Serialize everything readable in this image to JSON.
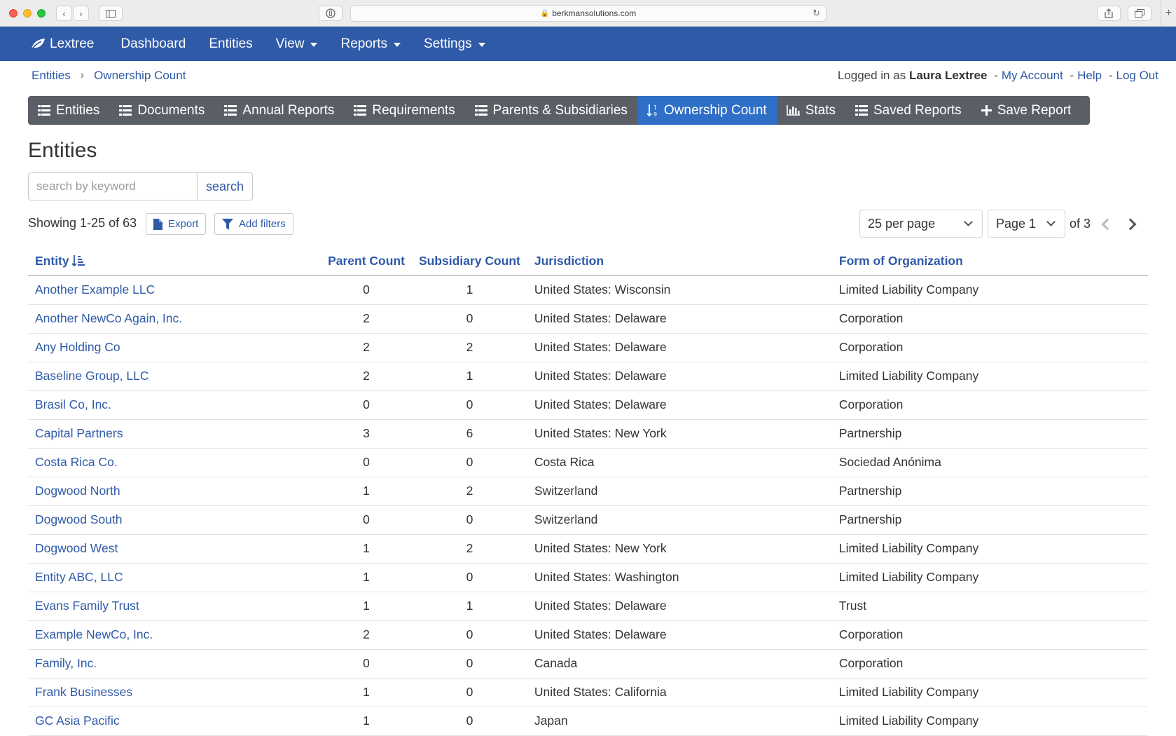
{
  "browser": {
    "url": "berkmansolutions.com"
  },
  "appnav": {
    "brand": "Lextree",
    "items": [
      {
        "label": "Dashboard",
        "dropdown": false
      },
      {
        "label": "Entities",
        "dropdown": false
      },
      {
        "label": "View",
        "dropdown": true
      },
      {
        "label": "Reports",
        "dropdown": true
      },
      {
        "label": "Settings",
        "dropdown": true
      }
    ]
  },
  "breadcrumb": {
    "items": [
      "Entities",
      "Ownership Count"
    ]
  },
  "user": {
    "prefix": "Logged in as",
    "name": "Laura Lextree",
    "my_account": "My Account",
    "help": "Help",
    "logout": "Log Out",
    "dash": "-"
  },
  "tabs": [
    {
      "label": "Entities",
      "icon": "list-icon",
      "active": false
    },
    {
      "label": "Documents",
      "icon": "list-icon",
      "active": false
    },
    {
      "label": "Annual Reports",
      "icon": "list-icon",
      "active": false
    },
    {
      "label": "Requirements",
      "icon": "list-icon",
      "active": false
    },
    {
      "label": "Parents & Subsidiaries",
      "icon": "list-icon",
      "active": false
    },
    {
      "label": "Ownership Count",
      "icon": "sort-numeric-icon",
      "active": true
    },
    {
      "label": "Stats",
      "icon": "bar-chart-icon",
      "active": false
    },
    {
      "label": "Saved Reports",
      "icon": "list-icon",
      "active": false
    },
    {
      "label": "Save Report",
      "icon": "plus-icon",
      "active": false
    }
  ],
  "page": {
    "title": "Entities"
  },
  "search": {
    "placeholder": "search by keyword",
    "value": "",
    "button": "search"
  },
  "toolbar": {
    "showing": "Showing 1-25 of 63",
    "export": "Export",
    "add_filters": "Add filters",
    "per_page": "25 per page",
    "page": "Page 1",
    "of_pages": "of 3"
  },
  "table": {
    "columns": [
      "Entity",
      "Parent Count",
      "Subsidiary Count",
      "Jurisdiction",
      "Form of Organization"
    ],
    "rows": [
      [
        "Another Example LLC",
        "0",
        "1",
        "United States: Wisconsin",
        "Limited Liability Company"
      ],
      [
        "Another NewCo Again, Inc.",
        "2",
        "0",
        "United States: Delaware",
        "Corporation"
      ],
      [
        "Any Holding Co",
        "2",
        "2",
        "United States: Delaware",
        "Corporation"
      ],
      [
        "Baseline Group, LLC",
        "2",
        "1",
        "United States: Delaware",
        "Limited Liability Company"
      ],
      [
        "Brasil Co, Inc.",
        "0",
        "0",
        "United States: Delaware",
        "Corporation"
      ],
      [
        "Capital Partners",
        "3",
        "6",
        "United States: New York",
        "Partnership"
      ],
      [
        "Costa Rica Co.",
        "0",
        "0",
        "Costa Rica",
        "Sociedad Anónima"
      ],
      [
        "Dogwood North",
        "1",
        "2",
        "Switzerland",
        "Partnership"
      ],
      [
        "Dogwood South",
        "0",
        "0",
        "Switzerland",
        "Partnership"
      ],
      [
        "Dogwood West",
        "1",
        "2",
        "United States: New York",
        "Limited Liability Company"
      ],
      [
        "Entity ABC, LLC",
        "1",
        "0",
        "United States: Washington",
        "Limited Liability Company"
      ],
      [
        "Evans Family Trust",
        "1",
        "1",
        "United States: Delaware",
        "Trust"
      ],
      [
        "Example NewCo, Inc.",
        "2",
        "0",
        "United States: Delaware",
        "Corporation"
      ],
      [
        "Family, Inc.",
        "0",
        "0",
        "Canada",
        "Corporation"
      ],
      [
        "Frank Businesses",
        "1",
        "0",
        "United States: California",
        "Limited Liability Company"
      ],
      [
        "GC Asia Pacific",
        "1",
        "0",
        "Japan",
        "Limited Liability Company"
      ]
    ]
  },
  "colors": {
    "nav": "#2f5aa8",
    "tabbar": "#5a5f67",
    "tab_active": "#2f6fc8",
    "link": "#2f5aa8"
  }
}
